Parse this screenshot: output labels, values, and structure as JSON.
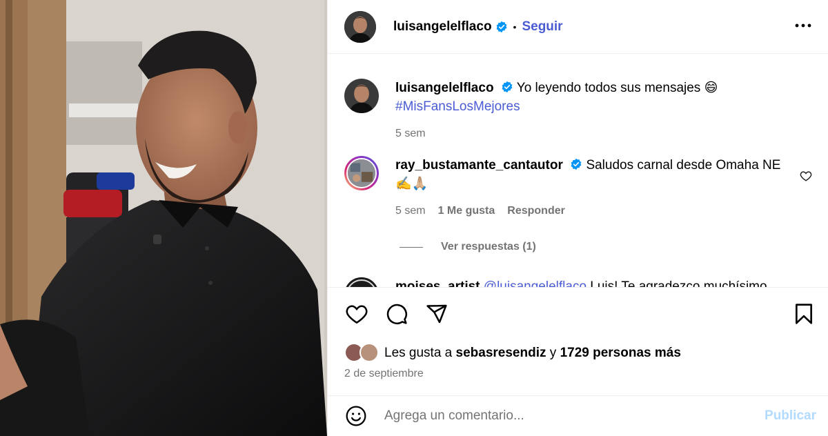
{
  "post": {
    "author": "luisangelelflaco",
    "follow_label": "Seguir",
    "separator": "•"
  },
  "caption": {
    "username": "luisangelelflaco",
    "text": "Yo leyendo todos sus mensajes 😄",
    "hashtag": "#MisFansLosMejores",
    "time": "5 sem"
  },
  "comments": [
    {
      "username": "ray_bustamante_cantautor",
      "text": "Saludos carnal desde Omaha NE",
      "emojis": "✍️🙏🏼",
      "time": "5 sem",
      "likes": "1 Me gusta",
      "reply_label": "Responder",
      "view_replies": "Ver respuestas (1)"
    },
    {
      "username": "moises_artist",
      "mention": "@luisangelelflaco",
      "text": "Luis! Te agradezco muchísimo"
    }
  ],
  "likes": {
    "prefix": "Les gusta a",
    "user": "sebasresendiz",
    "joiner": "y",
    "others": "1729 personas más"
  },
  "date": "2 de septiembre",
  "input": {
    "placeholder": "Agrega un comentario...",
    "publish_label": "Publicar"
  },
  "icons": [
    "more-icon",
    "verified-icon",
    "heart-icon",
    "comment-icon",
    "share-icon",
    "bookmark-icon",
    "emoji-icon"
  ],
  "colors": {
    "link": "#4a5bd4",
    "follow": "#0095f6",
    "verified": "#0095f6",
    "muted": "#737373",
    "publish_disabled": "#b3dbff"
  }
}
